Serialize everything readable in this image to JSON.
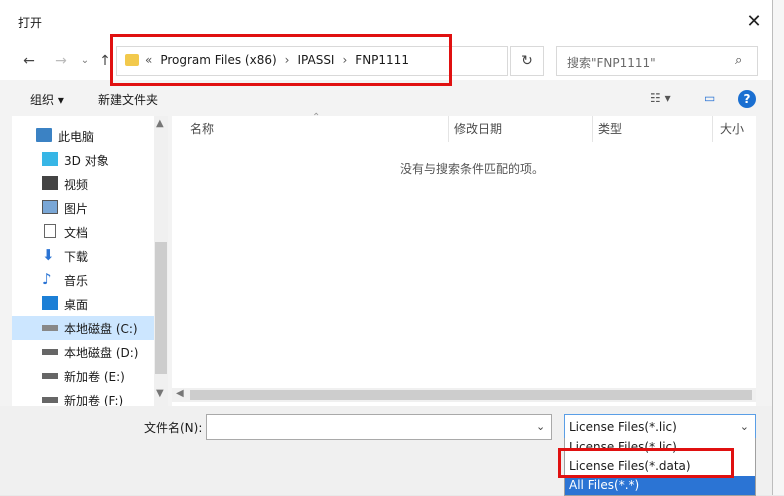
{
  "window": {
    "title": "打开",
    "close": "✕"
  },
  "nav": {
    "back": "←",
    "forward": "→",
    "recent": "⌄",
    "up": "↑",
    "breadcrumb": [
      "«",
      "Program Files (x86)",
      "›",
      "IPASSI",
      "›",
      "FNP1111"
    ],
    "dropdown": "⌄",
    "refresh": "↻",
    "search_placeholder": "搜索\"FNP1111\"",
    "search_icon": "⌕"
  },
  "toolbar": {
    "organize": "组织 ▾",
    "new_folder": "新建文件夹",
    "view": "☷ ▾",
    "pane": "▭",
    "help": "?"
  },
  "sidebar": {
    "items": [
      {
        "label": "此电脑",
        "icon": "computer-icon"
      },
      {
        "label": "3D 对象",
        "icon": "cube-icon"
      },
      {
        "label": "视频",
        "icon": "video-icon"
      },
      {
        "label": "图片",
        "icon": "picture-icon"
      },
      {
        "label": "文档",
        "icon": "document-icon"
      },
      {
        "label": "下载",
        "icon": "download-icon"
      },
      {
        "label": "音乐",
        "icon": "music-icon"
      },
      {
        "label": "桌面",
        "icon": "desktop-icon"
      },
      {
        "label": "本地磁盘 (C:)",
        "icon": "drive-icon"
      },
      {
        "label": "本地磁盘 (D:)",
        "icon": "drive-icon"
      },
      {
        "label": "新加卷 (E:)",
        "icon": "drive-icon"
      },
      {
        "label": "新加卷 (F:)",
        "icon": "drive-icon"
      }
    ]
  },
  "columns": {
    "name": "名称",
    "modified": "修改日期",
    "type": "类型",
    "size": "大小"
  },
  "empty_message": "没有与搜索条件匹配的项。",
  "filename": {
    "label": "文件名(N):",
    "value": ""
  },
  "filetype": {
    "selected": "License Files(*.lic)",
    "options": [
      "License Files(*.lic)",
      "License Files(*.data)",
      "All Files(*.*)"
    ]
  },
  "colors": {
    "highlight": "#e01010",
    "accent": "#2b74d4"
  }
}
